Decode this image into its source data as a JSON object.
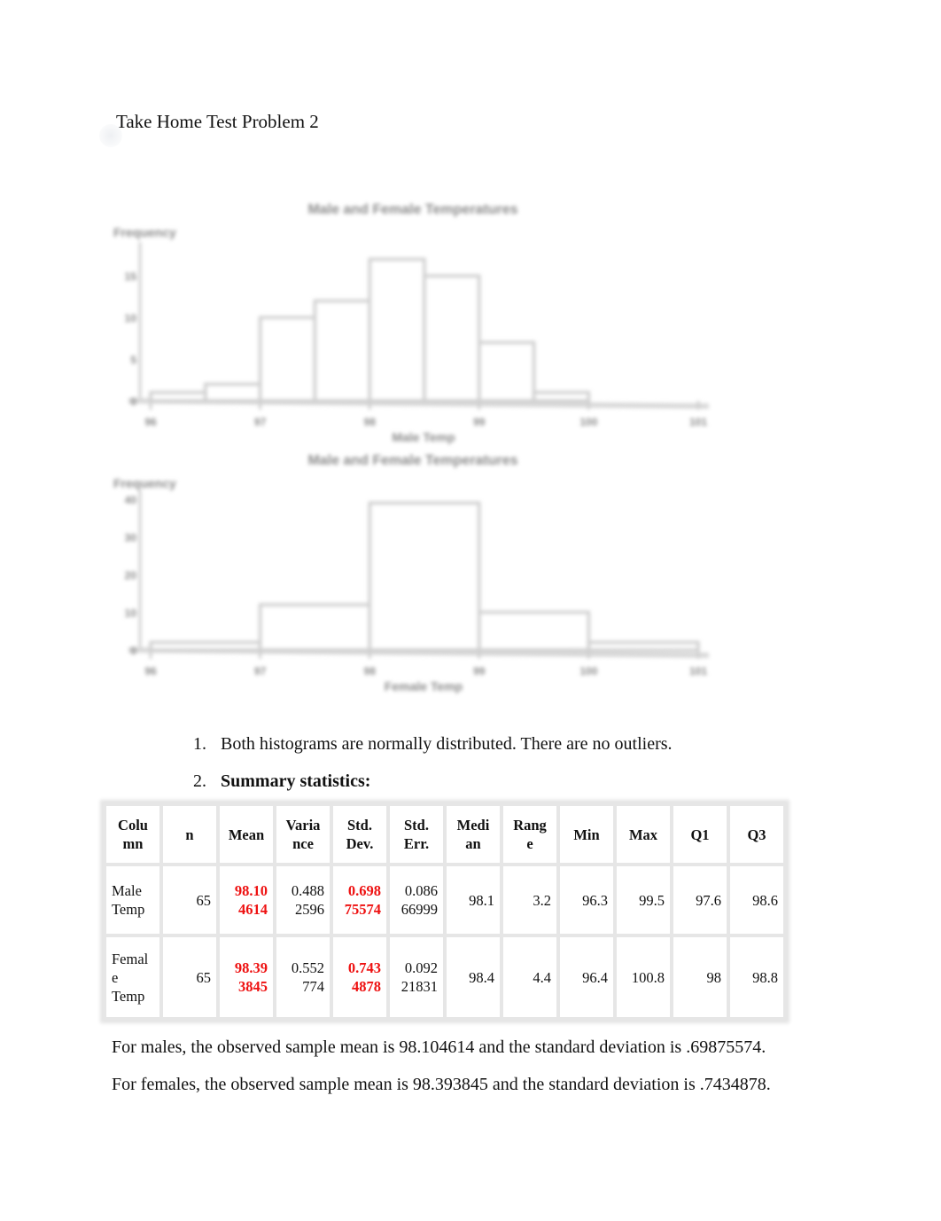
{
  "document": {
    "title": "Take Home Test Problem 2"
  },
  "chart_data": [
    {
      "type": "bar",
      "title": "Male and Female Temperatures",
      "xlabel": "Male Temp",
      "ylabel": "Frequency",
      "bin_edges": [
        96,
        96.5,
        97,
        97.5,
        98,
        98.5,
        99,
        99.5,
        100
      ],
      "values": [
        1,
        2,
        10,
        12,
        17,
        15,
        7,
        1
      ],
      "x_ticks": [
        96,
        97,
        98,
        99,
        100,
        101
      ],
      "y_ticks": [
        0,
        5,
        10,
        15
      ],
      "xlim": [
        96,
        101
      ],
      "ylim": [
        0,
        18
      ],
      "grid": false,
      "legend": "none"
    },
    {
      "type": "bar",
      "title": "Male and Female Temperatures",
      "xlabel": "Female Temp",
      "ylabel": "Frequency",
      "bin_edges": [
        96,
        97,
        98,
        99,
        100,
        101
      ],
      "values": [
        2,
        12,
        39,
        10,
        2
      ],
      "x_ticks": [
        96,
        97,
        98,
        99,
        100,
        101
      ],
      "y_ticks": [
        0,
        10,
        20,
        30,
        40
      ],
      "xlim": [
        96,
        101
      ],
      "ylim": [
        0,
        40
      ],
      "grid": false,
      "legend": "none"
    }
  ],
  "list": [
    {
      "number": "1.",
      "text": "Both histograms are normally distributed.  There are no outliers."
    },
    {
      "number": "2.",
      "text": "Summary statistics:"
    }
  ],
  "table": {
    "headers": [
      "Colu mn",
      "n",
      "Mean",
      "Varia nce",
      "Std. Dev.",
      "Std. Err.",
      "Medi an",
      "Rang e",
      "Min",
      "Max",
      "Q1",
      "Q3"
    ],
    "rows": [
      {
        "label": "Male Temp",
        "n": "65",
        "mean": "98.104614",
        "variance": "0.4882596",
        "std_dev": "0.69875574",
        "std_err": "0.08666999",
        "median": "98.1",
        "range": "3.2",
        "min": "96.3",
        "max": "99.5",
        "q1": "97.6",
        "q3": "98.6"
      },
      {
        "label": "Female Temp",
        "n": "65",
        "mean": "98.393845",
        "variance": "0.552774",
        "std_dev": "0.7434878",
        "std_err": "0.09221831",
        "median": "98.4",
        "range": "4.4",
        "min": "96.4",
        "max": "100.8",
        "q1": "98",
        "q3": "98.8"
      }
    ],
    "highlight_color": "#ee1111"
  },
  "paragraphs": [
    "For males, the observed sample mean is 98.104614 and the standard deviation is .69875574.",
    "For females, the observed sample mean is 98.393845 and the standard deviation is .7434878."
  ]
}
